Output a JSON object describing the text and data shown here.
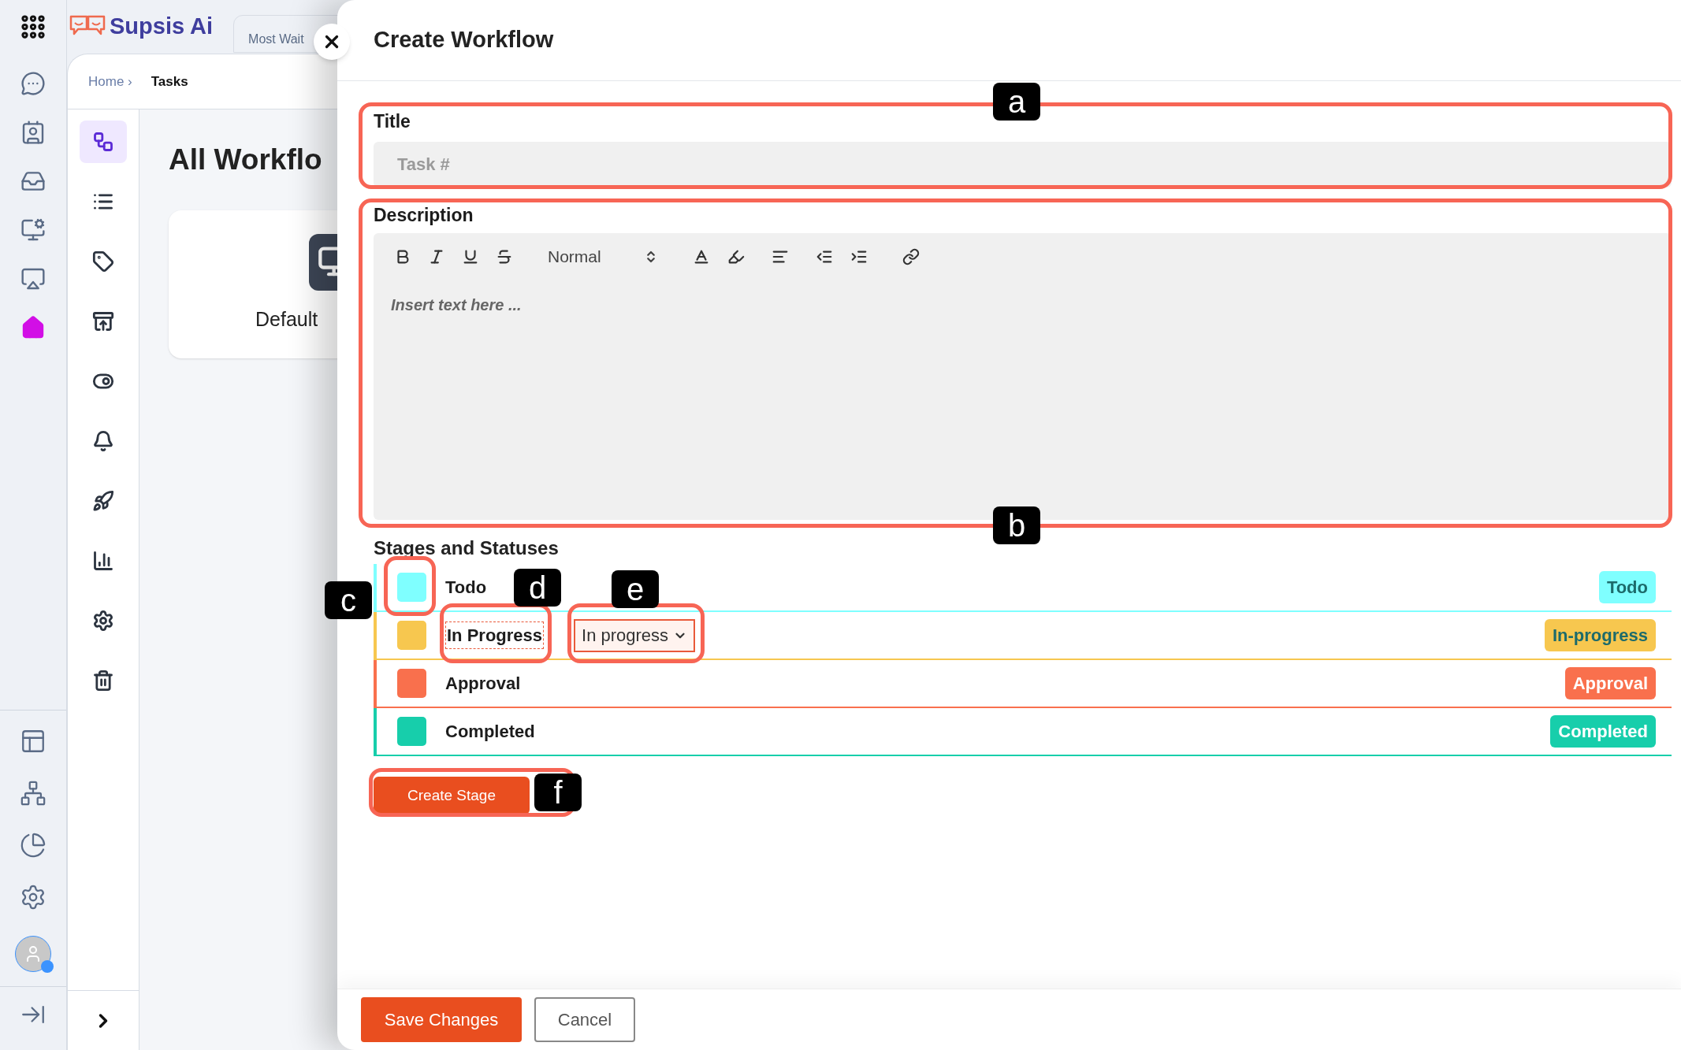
{
  "app": {
    "name": "Supsis Ai"
  },
  "tab": {
    "label": "Most Wait"
  },
  "rail": {
    "items": [
      {
        "selected": false
      },
      {
        "selected": false
      },
      {
        "selected": false
      },
      {
        "selected": false
      },
      {
        "selected": false
      },
      {
        "selected": true
      }
    ]
  },
  "breadcrumb": [
    {
      "label": "Home ›",
      "selected": false
    },
    {
      "label": "Tasks",
      "selected": true
    }
  ],
  "sidebar": {
    "items": [
      {
        "selected": true
      },
      {
        "selected": false
      },
      {
        "selected": false
      },
      {
        "selected": false
      },
      {
        "selected": false
      },
      {
        "selected": false
      },
      {
        "selected": false
      },
      {
        "selected": false
      },
      {
        "selected": false
      },
      {
        "selected": false
      }
    ]
  },
  "page": {
    "title": "All Workflo",
    "cards": [
      {
        "label": "Default"
      }
    ]
  },
  "modal": {
    "title": "Create Workflow",
    "title_field": {
      "label": "Title",
      "placeholder": "Task #"
    },
    "description_field": {
      "label": "Description",
      "placeholder": "Insert text here ...",
      "heading_select": "Normal"
    },
    "stages_heading": "Stages and Statuses",
    "stages": [
      {
        "name": "Todo",
        "color": "#7fffff",
        "badge": "Todo",
        "editing": false
      },
      {
        "name": "In Progress",
        "color": "#f7c74f",
        "badge": "In-progress",
        "editing": true,
        "status_value": "In progress"
      },
      {
        "name": "Approval",
        "color": "#f9704d",
        "badge": "Approval",
        "editing": false
      },
      {
        "name": "Completed",
        "color": "#17ceab",
        "badge": "Completed",
        "editing": false
      }
    ],
    "create_stage_button": "Create Stage",
    "save_button": "Save Changes",
    "cancel_button": "Cancel"
  },
  "annotations": [
    {
      "label": "a"
    },
    {
      "label": "b"
    },
    {
      "label": "c"
    },
    {
      "label": "d"
    },
    {
      "label": "e"
    },
    {
      "label": "f"
    }
  ]
}
